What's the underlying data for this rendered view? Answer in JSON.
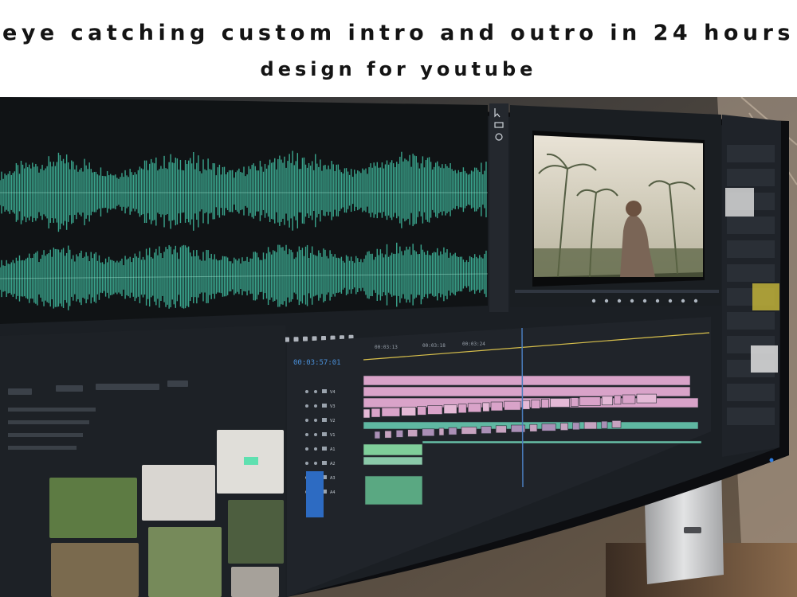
{
  "headline": {
    "line1": "eye catching custom intro and outro in 24 hours",
    "line2": "design for youtube"
  },
  "editor": {
    "timecode": "00:03:57:01",
    "timeline_markers": [
      "00:03:13",
      "00:03:18",
      "00:03:24"
    ],
    "track_labels": [
      "V4",
      "V3",
      "V2",
      "V1",
      "A1",
      "A2",
      "A3",
      "A4"
    ],
    "icons": [
      "play-icon",
      "step-back-icon",
      "step-forward-icon",
      "loop-icon",
      "export-icon",
      "camera-icon",
      "selection-tool-icon",
      "razor-tool-icon"
    ]
  },
  "colors": {
    "waveform": "#3fb59a",
    "clip_pink": "#d9a3c9",
    "clip_teal": "#5fb8a2",
    "clip_green": "#7fcf9a",
    "playhead": "#4a7dbd",
    "panel_dark": "#23272e",
    "bezel": "#0c0d10"
  }
}
